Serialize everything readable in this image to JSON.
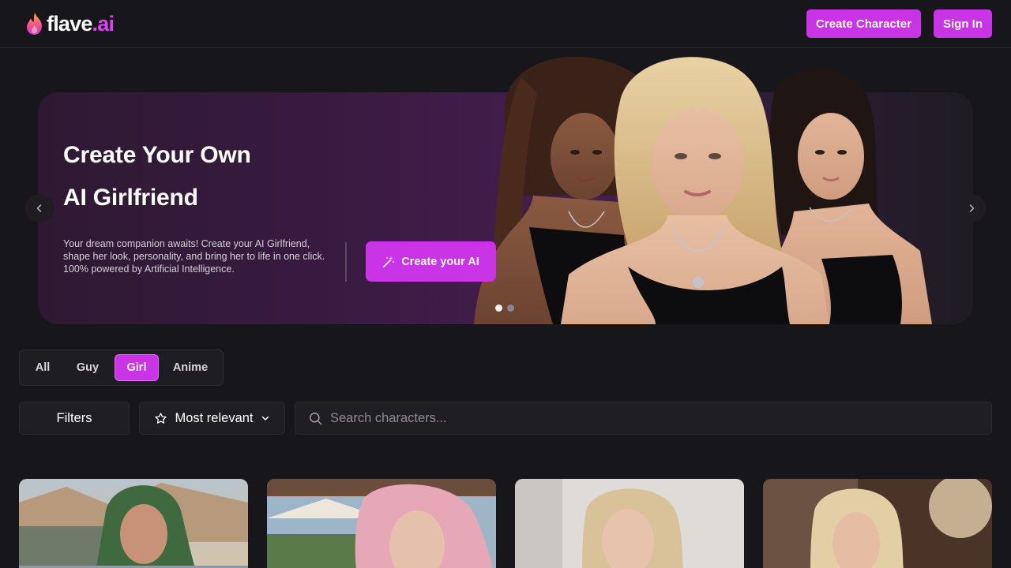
{
  "header": {
    "logo_main": "flave",
    "logo_dot_ai": ".ai",
    "create_character_label": "Create Character",
    "sign_in_label": "Sign In"
  },
  "hero": {
    "title_line1": "Create Your Own",
    "title_line2": "AI Girlfriend",
    "description": "Your dream companion awaits! Create your AI Girlfriend, shape her look, personality, and bring her to life in one click. 100% powered by Artificial Intelligence.",
    "cta_label": "Create your AI",
    "slide_count": 2,
    "active_slide": 1
  },
  "categories": {
    "tabs": [
      {
        "label": "All"
      },
      {
        "label": "Guy"
      },
      {
        "label": "Girl"
      },
      {
        "label": "Anime"
      }
    ],
    "active": "Girl"
  },
  "toolbar": {
    "filters_label": "Filters",
    "sort_label": "Most relevant",
    "search_placeholder": "Search characters..."
  },
  "icons": {
    "logo": "flame-icon",
    "cta": "magic-wand-icon",
    "sort": "star-icon",
    "sort_toggle": "chevron-down-icon",
    "search": "search-icon",
    "prev": "chevron-left-icon",
    "next": "chevron-right-icon"
  },
  "colors": {
    "accent": "#c934e6",
    "background": "#17161a",
    "surface": "#1f1e22"
  }
}
